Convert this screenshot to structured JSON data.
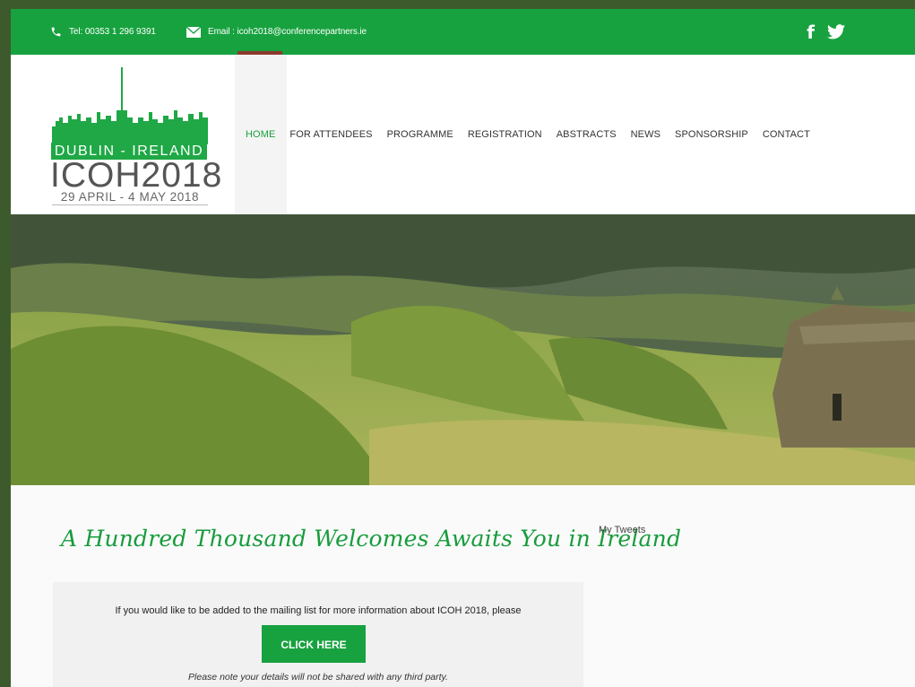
{
  "topbar": {
    "tel": "Tel: 00353 1 296 9391",
    "email": "Email : icoh2018@conferencepartners.ie",
    "social": {
      "facebook_icon": "facebook-icon",
      "twitter_icon": "twitter-icon"
    }
  },
  "logo": {
    "location": "DUBLIN - IRELAND",
    "title": "ICOH2018",
    "dates": "29 APRIL - 4 MAY 2018"
  },
  "nav": {
    "items": [
      {
        "label": "HOME",
        "active": true
      },
      {
        "label": "FOR ATTENDEES"
      },
      {
        "label": "PROGRAMME"
      },
      {
        "label": "REGISTRATION"
      },
      {
        "label": "ABSTRACTS"
      },
      {
        "label": "NEWS"
      },
      {
        "label": "SPONSORSHIP"
      },
      {
        "label": "CONTACT"
      }
    ]
  },
  "content": {
    "welcome": "A Hundred Thousand Welcomes Awaits You in Ireland",
    "tweets_title": "My Tweets",
    "mailing": {
      "message": "If you would like to be added to the mailing list for more information about ICOH 2018, please",
      "button": "CLICK HERE",
      "note": "Please note your details will not be shared with any third party."
    }
  },
  "colors": {
    "brand_green": "#17a23f",
    "frame": "#3d5a2c"
  }
}
